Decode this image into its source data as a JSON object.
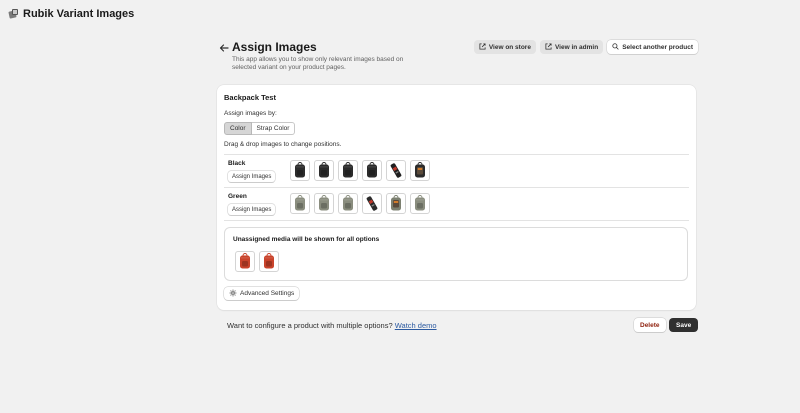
{
  "app": {
    "title": "Rubik Variant Images",
    "logo_icon": "app-logo-icon"
  },
  "header": {
    "back_icon": "arrow-left-icon",
    "title": "Assign Images",
    "subtitle": "This app allows you to show only relevant images based on selected variant on your product pages.",
    "actions": {
      "view_store": "View on store",
      "view_admin": "View in admin",
      "select_product": "Select another product"
    }
  },
  "card": {
    "product_name": "Backpack Test",
    "assign_by_label": "Assign images by:",
    "options": [
      "Color",
      "Strap Color"
    ],
    "selected_option": "Color",
    "drag_hint": "Drag & drop images to change positions.",
    "variants": [
      {
        "name": "Black",
        "button": "Assign Images",
        "images": [
          {
            "kind": "backpack",
            "color": "#2b2b2b"
          },
          {
            "kind": "backpack",
            "color": "#2b2b2b"
          },
          {
            "kind": "backpack",
            "color": "#2b2b2b"
          },
          {
            "kind": "backpack",
            "color": "#2b2b2b"
          },
          {
            "kind": "strap",
            "color": "#1f1f1f"
          },
          {
            "kind": "backpack-open",
            "color": "#2b2b2b"
          }
        ]
      },
      {
        "name": "Green",
        "button": "Assign Images",
        "images": [
          {
            "kind": "backpack",
            "color": "#8a8d7e"
          },
          {
            "kind": "backpack",
            "color": "#8a8d7e"
          },
          {
            "kind": "backpack",
            "color": "#8a8d7e"
          },
          {
            "kind": "strap",
            "color": "#2a2a2a"
          },
          {
            "kind": "backpack-open",
            "color": "#7c8070"
          },
          {
            "kind": "backpack",
            "color": "#8a8d7e"
          }
        ]
      }
    ],
    "unassigned": {
      "title": "Unassigned media will be shown for all options",
      "images": [
        {
          "kind": "backpack",
          "color": "#c9432b"
        },
        {
          "kind": "backpack",
          "color": "#c9432b"
        }
      ]
    },
    "advanced_settings": "Advanced Settings"
  },
  "footer": {
    "text": "Want to configure a product with multiple options?",
    "link": "Watch demo",
    "delete": "Delete",
    "save": "Save"
  }
}
